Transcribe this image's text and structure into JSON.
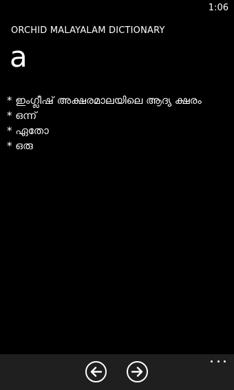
{
  "status_bar": {
    "time": "1:06"
  },
  "app": {
    "title": "ORCHID MALAYALAM DICTIONARY"
  },
  "entry": {
    "headword": "a",
    "definitions": [
      "* ഇംഗ്ലീഷ് അക്ഷരമാലയിലെ ആദ്യ ക്ഷരം",
      "* ഒന്ന്",
      "* ഏതോ",
      "* ഒരു"
    ]
  },
  "app_bar": {
    "back_icon": "arrow-left-circle-icon",
    "forward_icon": "arrow-right-circle-icon",
    "more_icon": "ellipsis-icon"
  },
  "colors": {
    "background": "#000000",
    "text": "#ffffff",
    "app_bar": "#1f1f1f"
  }
}
